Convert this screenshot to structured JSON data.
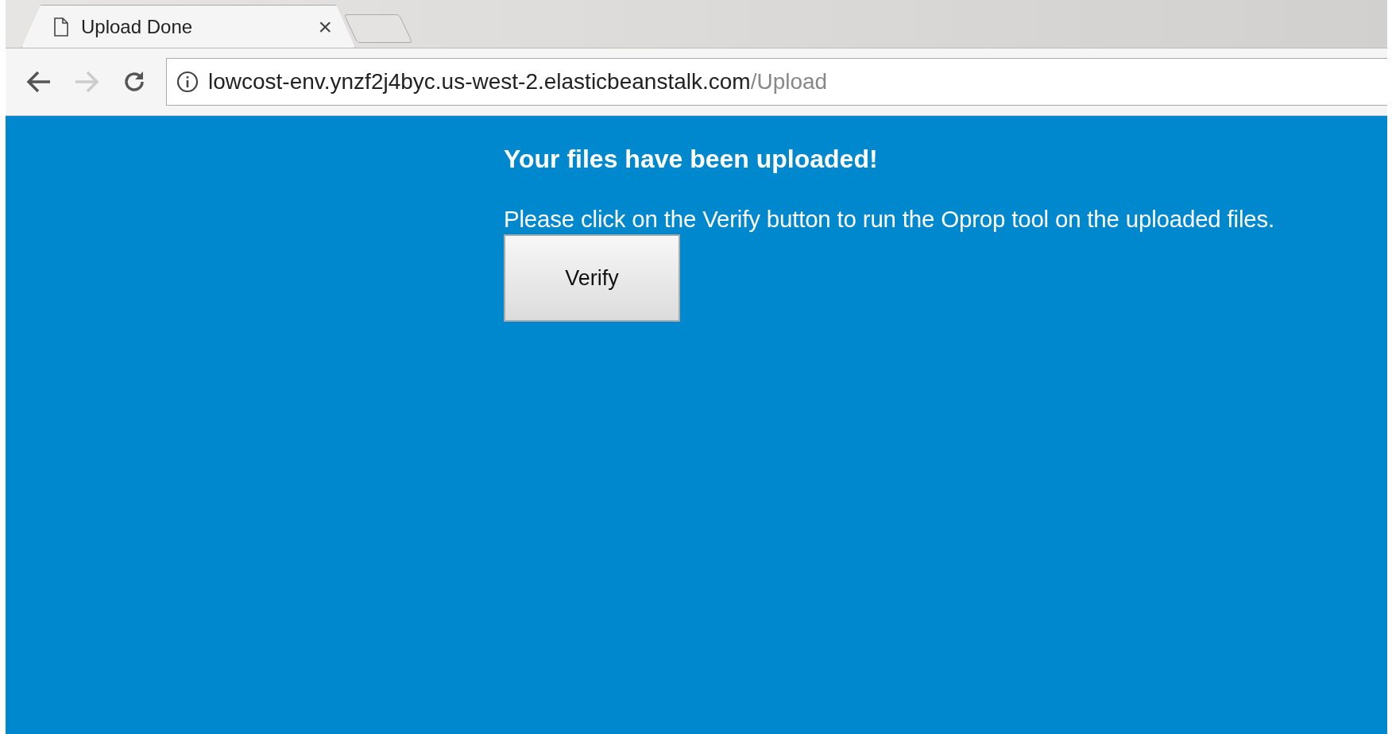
{
  "tab": {
    "title": "Upload Done",
    "close": "×",
    "selected": true
  },
  "address_bar": {
    "host": "lowcost-env.ynzf2j4byc.us-west-2.elasticbeanstalk.com",
    "path": "/Upload"
  },
  "page": {
    "heading": "Your files have been uploaded!",
    "message": "Please click on the Verify button to run the Oprop tool on the uploaded files.",
    "button": "Verify"
  }
}
